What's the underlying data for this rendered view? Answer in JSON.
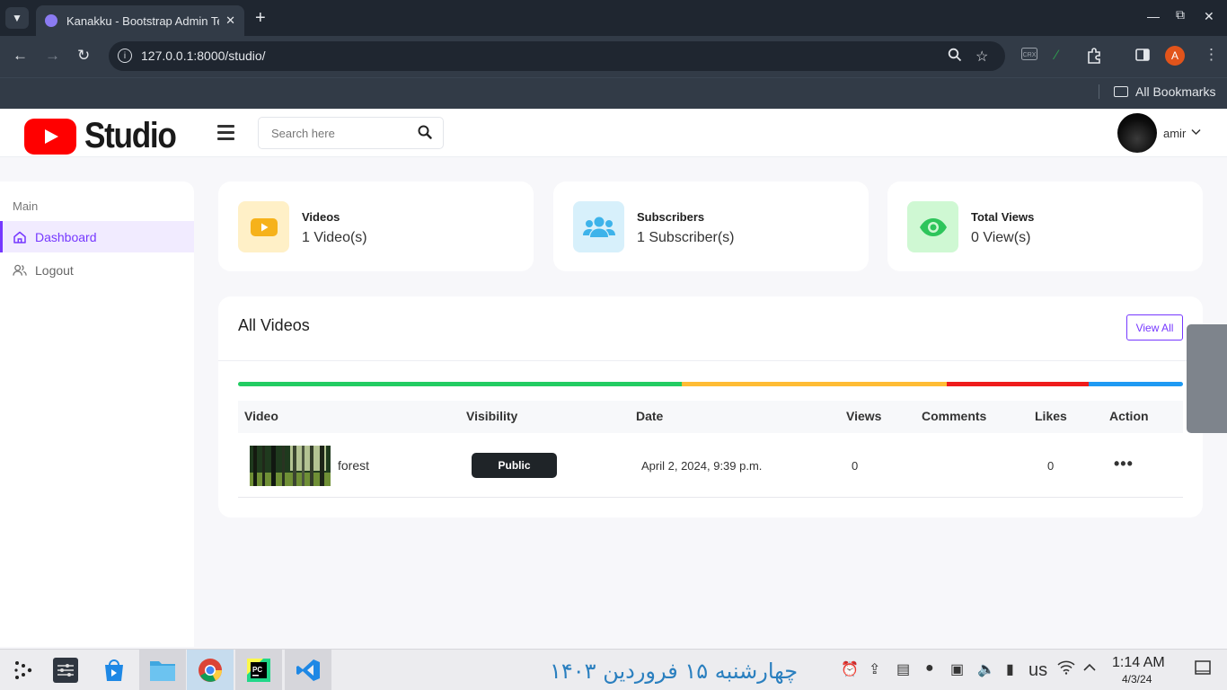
{
  "browser": {
    "tab_title": "Kanakku - Bootstrap Admin Template",
    "url": "127.0.0.1:8000/studio/",
    "bookmarks_label": "All Bookmarks",
    "profile_initial": "A"
  },
  "header": {
    "logo_text": "Studio",
    "search_placeholder": "Search here",
    "user_name": "amir"
  },
  "sidebar": {
    "section": "Main",
    "items": [
      {
        "label": "Dashboard",
        "active": true
      },
      {
        "label": "Logout",
        "active": false
      }
    ]
  },
  "stats": [
    {
      "title": "Videos",
      "value": "1 Video(s)",
      "icon": "play-icon",
      "bg": "#fff0c7",
      "fg": "#f6b21b"
    },
    {
      "title": "Subscribers",
      "value": "1 Subscriber(s)",
      "icon": "users-icon",
      "bg": "#d7f0fb",
      "fg": "#3db3ea"
    },
    {
      "title": "Total Views",
      "value": "0 View(s)",
      "icon": "eye-icon",
      "bg": "#cff8d3",
      "fg": "#2ec55b"
    }
  ],
  "videos": {
    "title": "All Videos",
    "view_all": "View All",
    "progress_segments": [
      {
        "color": "#22cc62",
        "share": 47
      },
      {
        "color": "#ffbc34",
        "share": 28
      },
      {
        "color": "#ef1b1b",
        "share": 15
      },
      {
        "color": "#1f9af3",
        "share": 10
      }
    ],
    "columns": [
      "Video",
      "Visibility",
      "Date",
      "Views",
      "Comments",
      "Likes",
      "Action"
    ],
    "rows": [
      {
        "name": "forest",
        "visibility": "Public",
        "date": "April 2, 2024, 9:39 p.m.",
        "views": "0",
        "comments": "",
        "likes": "0"
      }
    ]
  },
  "taskbar": {
    "persian_date": "چهارشنبه ۱۵ فروردین ۱۴۰۳",
    "keyboard_layout": "us",
    "time": "1:14 AM",
    "date": "4/3/24"
  }
}
